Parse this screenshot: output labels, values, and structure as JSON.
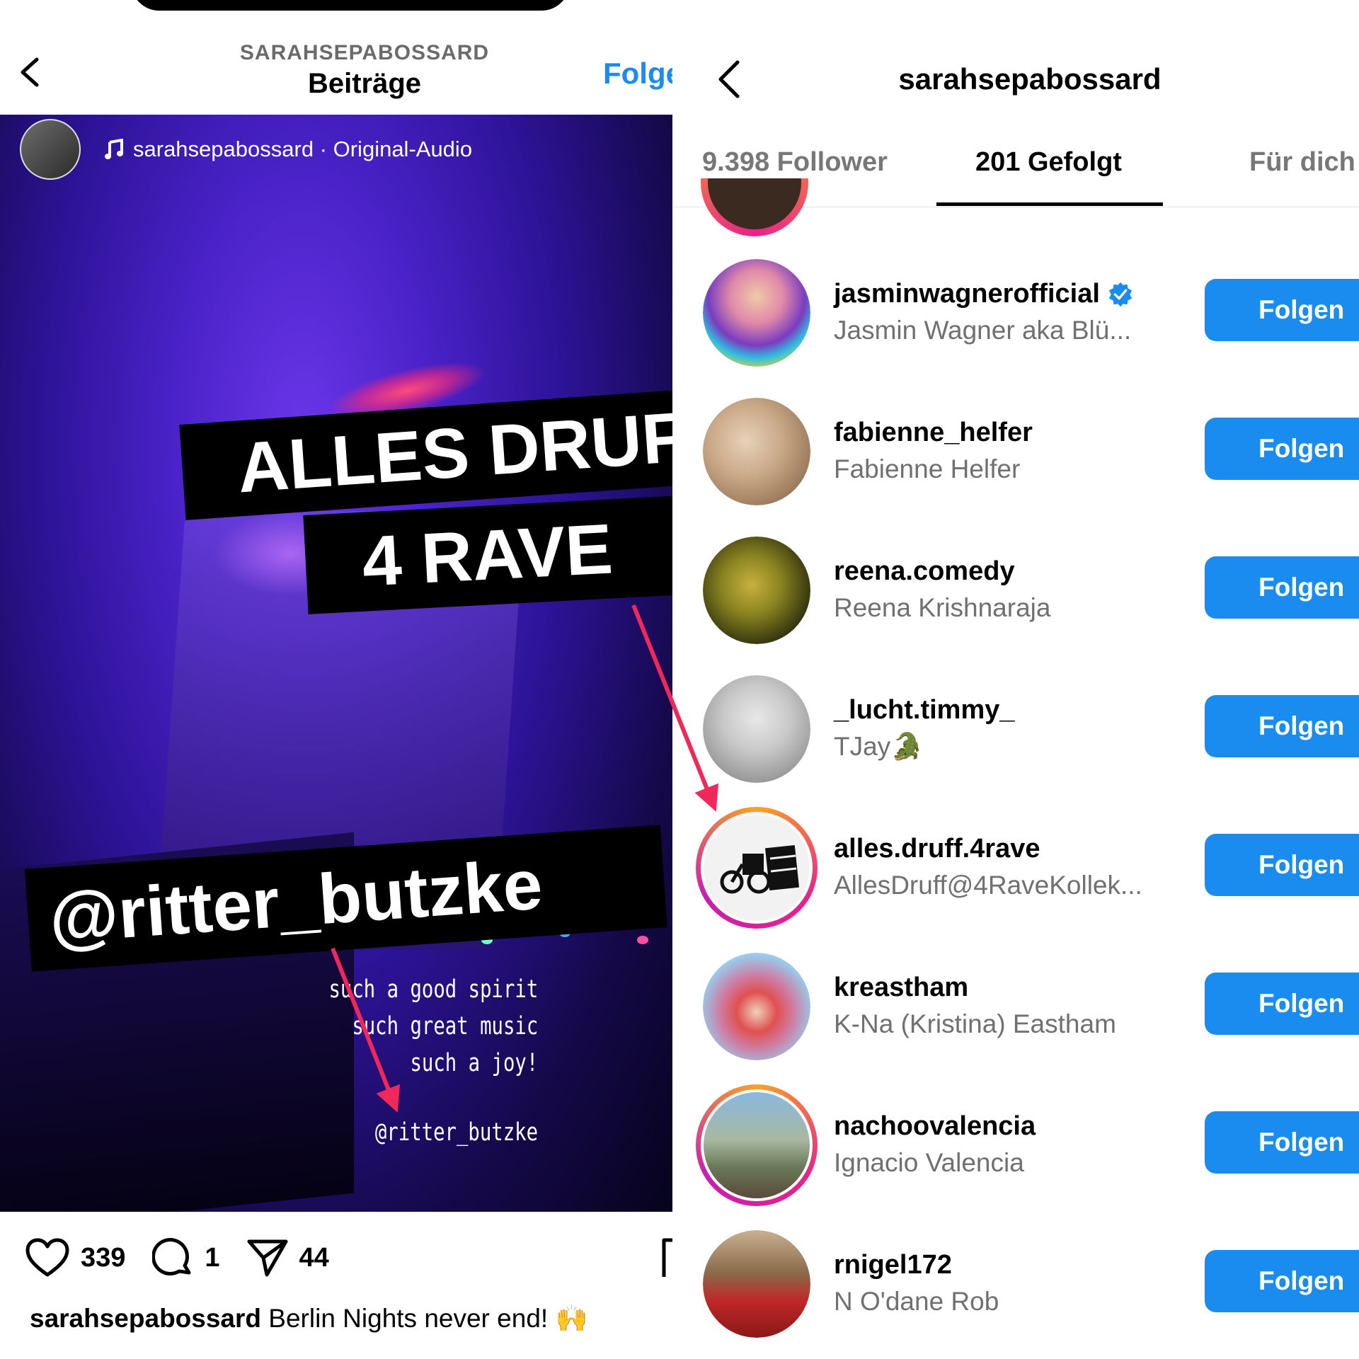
{
  "left": {
    "header": {
      "subtitle": "SARAHSEPABOSSARD",
      "title": "Beiträge",
      "follow_label": "Folgen"
    },
    "audio": {
      "username": "sarahsepabossard",
      "separator": " · ",
      "track": "Original-Audio"
    },
    "stickers": {
      "line1": "ALLES DRUFF",
      "line2": "4 RAVE",
      "mention": "@ritter_butzke"
    },
    "overlay_caption": [
      "such a good spirit",
      "such great music",
      "such a joy!"
    ],
    "overlay_tag": "@ritter_butzke",
    "actions": {
      "likes": "339",
      "comments": "1",
      "shares": "44"
    },
    "caption": {
      "user": "sarahsepabossard",
      "text": " Berlin Nights never end! 🙌"
    }
  },
  "right": {
    "title": "sarahsepabossard",
    "tabs": [
      {
        "label": "9.398 Follower"
      },
      {
        "label": "201 Gefolgt",
        "active": true
      },
      {
        "label": "Für dich"
      }
    ],
    "button_label": "Folgen",
    "accounts": [
      {
        "username": "jasminwagnerofficial",
        "name": "Jasmin Wagner aka Blü...",
        "verified": true,
        "story_ring": false
      },
      {
        "username": "fabienne_helfer",
        "name": "Fabienne Helfer",
        "verified": false,
        "story_ring": false
      },
      {
        "username": "reena.comedy",
        "name": "Reena Krishnaraja",
        "verified": false,
        "story_ring": false
      },
      {
        "username": "_lucht.timmy_",
        "name": "TJay🐊",
        "verified": false,
        "story_ring": false
      },
      {
        "username": "alles.druff.4rave",
        "name": "AllesDruff@4RaveKollek...",
        "verified": false,
        "story_ring": true
      },
      {
        "username": "kreastham",
        "name": "K-Na (Kristina) Eastham",
        "verified": false,
        "story_ring": false
      },
      {
        "username": "nachoovalencia",
        "name": "Ignacio Valencia",
        "verified": false,
        "story_ring": true
      },
      {
        "username": "rnigel172",
        "name": "N O'dane Rob",
        "verified": false,
        "story_ring": false
      }
    ]
  },
  "colors": {
    "accent_blue": "#1a8cf0",
    "arrow_red": "#f0285a",
    "ring_orange": "#f9a324",
    "ring_pink": "#e8228a"
  }
}
